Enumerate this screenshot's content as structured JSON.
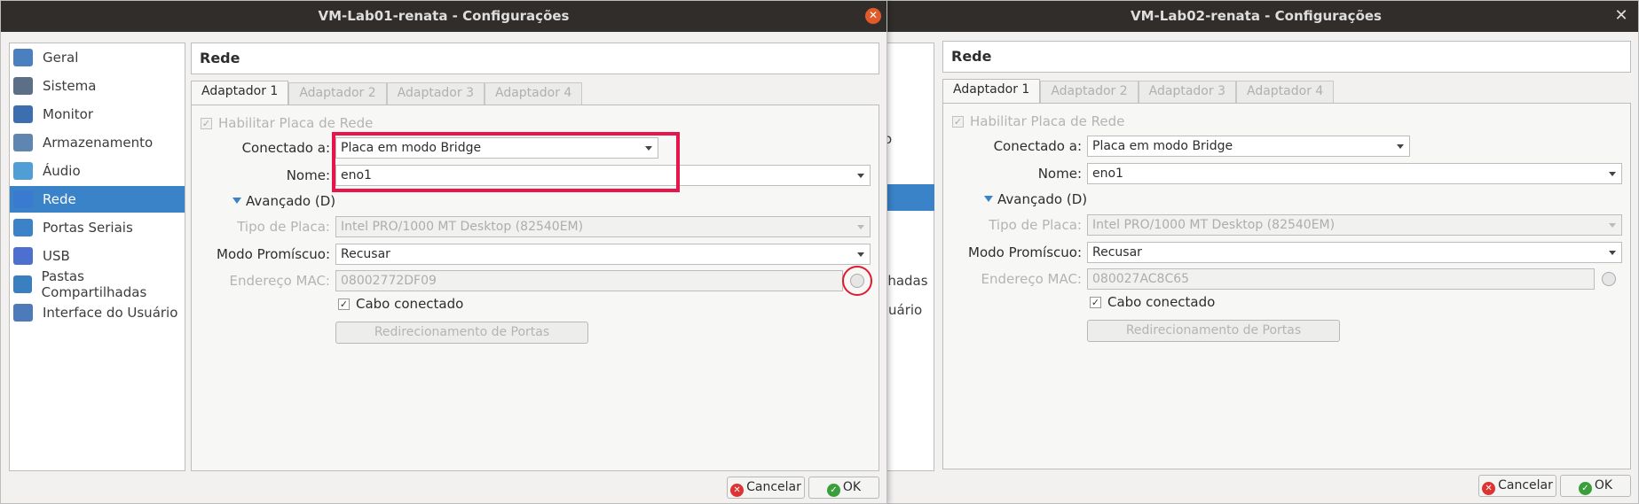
{
  "colors": {
    "selection": "#3a83c8",
    "highlight_red": "#e8154b",
    "titlebar": "#302d2b"
  },
  "dialog1": {
    "title": "VM-Lab01-renata - Configurações",
    "sidebar": [
      {
        "label": "Geral",
        "icon": "general-icon"
      },
      {
        "label": "Sistema",
        "icon": "system-icon"
      },
      {
        "label": "Monitor",
        "icon": "monitor-icon"
      },
      {
        "label": "Armazenamento",
        "icon": "storage-icon"
      },
      {
        "label": "Áudio",
        "icon": "audio-icon"
      },
      {
        "label": "Rede",
        "icon": "network-icon",
        "selected": true
      },
      {
        "label": "Portas Seriais",
        "icon": "serial-ports-icon"
      },
      {
        "label": "USB",
        "icon": "usb-icon"
      },
      {
        "label": "Pastas Compartilhadas",
        "icon": "shared-folders-icon"
      },
      {
        "label": "Interface do Usuário",
        "icon": "user-interface-icon"
      }
    ],
    "section": "Rede",
    "tabs": [
      "Adaptador 1",
      "Adaptador 2",
      "Adaptador 3",
      "Adaptador 4"
    ],
    "enable_label": "Habilitar Placa de Rede",
    "attached_label": "Conectado a:",
    "attached_value": "Placa em modo Bridge",
    "name_label": "Nome:",
    "name_value": "eno1",
    "advanced_label": "Avançado (D)",
    "adapter_type_label": "Tipo de Placa:",
    "adapter_type_value": "Intel PRO/1000 MT Desktop (82540EM)",
    "promisc_label": "Modo Promíscuo:",
    "promisc_value": "Recusar",
    "mac_label": "Endereço MAC:",
    "mac_value": "08002772DF09",
    "cable_label": "Cabo conectado",
    "port_forward_label": "Redirecionamento de Portas",
    "cancel_label": "Cancelar",
    "ok_label": "OK"
  },
  "dialog2": {
    "title": "VM-Lab02-renata - Configurações",
    "section": "Rede",
    "tabs": [
      "Adaptador 1",
      "Adaptador 2",
      "Adaptador 3",
      "Adaptador 4"
    ],
    "enable_label": "Habilitar Placa de Rede",
    "attached_label": "Conectado a:",
    "attached_value": "Placa em modo Bridge",
    "name_label": "Nome:",
    "name_value": "eno1",
    "advanced_label": "Avançado (D)",
    "adapter_type_label": "Tipo de Placa:",
    "adapter_type_value": "Intel PRO/1000 MT Desktop (82540EM)",
    "promisc_label": "Modo Promíscuo:",
    "promisc_value": "Recusar",
    "mac_label": "Endereço MAC:",
    "mac_value": "080027AC8C65",
    "cable_label": "Cabo conectado",
    "port_forward_label": "Redirecionamento de Portas",
    "cancel_label": "Cancelar",
    "ok_label": "OK",
    "peek_texts": [
      "o",
      "ilhadas",
      "uário"
    ]
  }
}
